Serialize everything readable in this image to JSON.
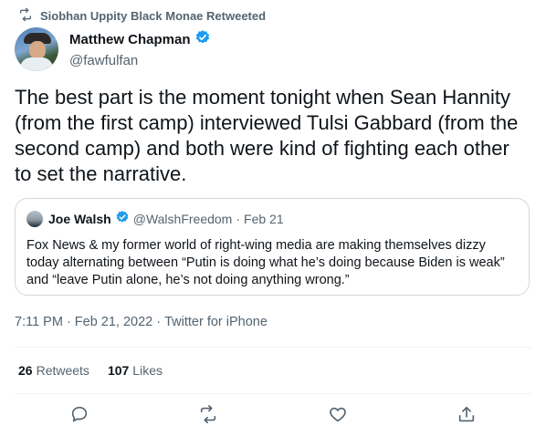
{
  "retweet_banner": {
    "text": "Siobhan Uppity Black Monae Retweeted",
    "icon": "retweet-icon"
  },
  "author": {
    "display_name": "Matthew Chapman",
    "handle": "@fawfulfan",
    "verified": true
  },
  "tweet": {
    "text": "The best part is the moment tonight when Sean Hannity (from the first camp) interviewed Tulsi Gabbard (from the second camp) and both were kind of fighting each other to set the narrative."
  },
  "quote": {
    "display_name": "Joe Walsh",
    "handle": "@WalshFreedom",
    "separator": "·",
    "date": "Feb 21",
    "verified": true,
    "text": "Fox News & my former world of right-wing media are making themselves dizzy today alternating between “Putin is doing what he’s doing because Biden is weak” and “leave Putin alone, he’s not doing anything wrong.”"
  },
  "meta": {
    "time": "7:11 PM",
    "sep1": "·",
    "date": "Feb 21, 2022",
    "sep2": "·",
    "source": "Twitter for iPhone"
  },
  "stats": {
    "retweets_count": "26",
    "retweets_label": "Retweets",
    "likes_count": "107",
    "likes_label": "Likes"
  },
  "actions": [
    "reply-icon",
    "retweet-icon",
    "like-icon",
    "share-icon"
  ],
  "colors": {
    "verified": "#1d9bf0",
    "secondary_text": "#536471",
    "divider": "#eff3f4"
  }
}
